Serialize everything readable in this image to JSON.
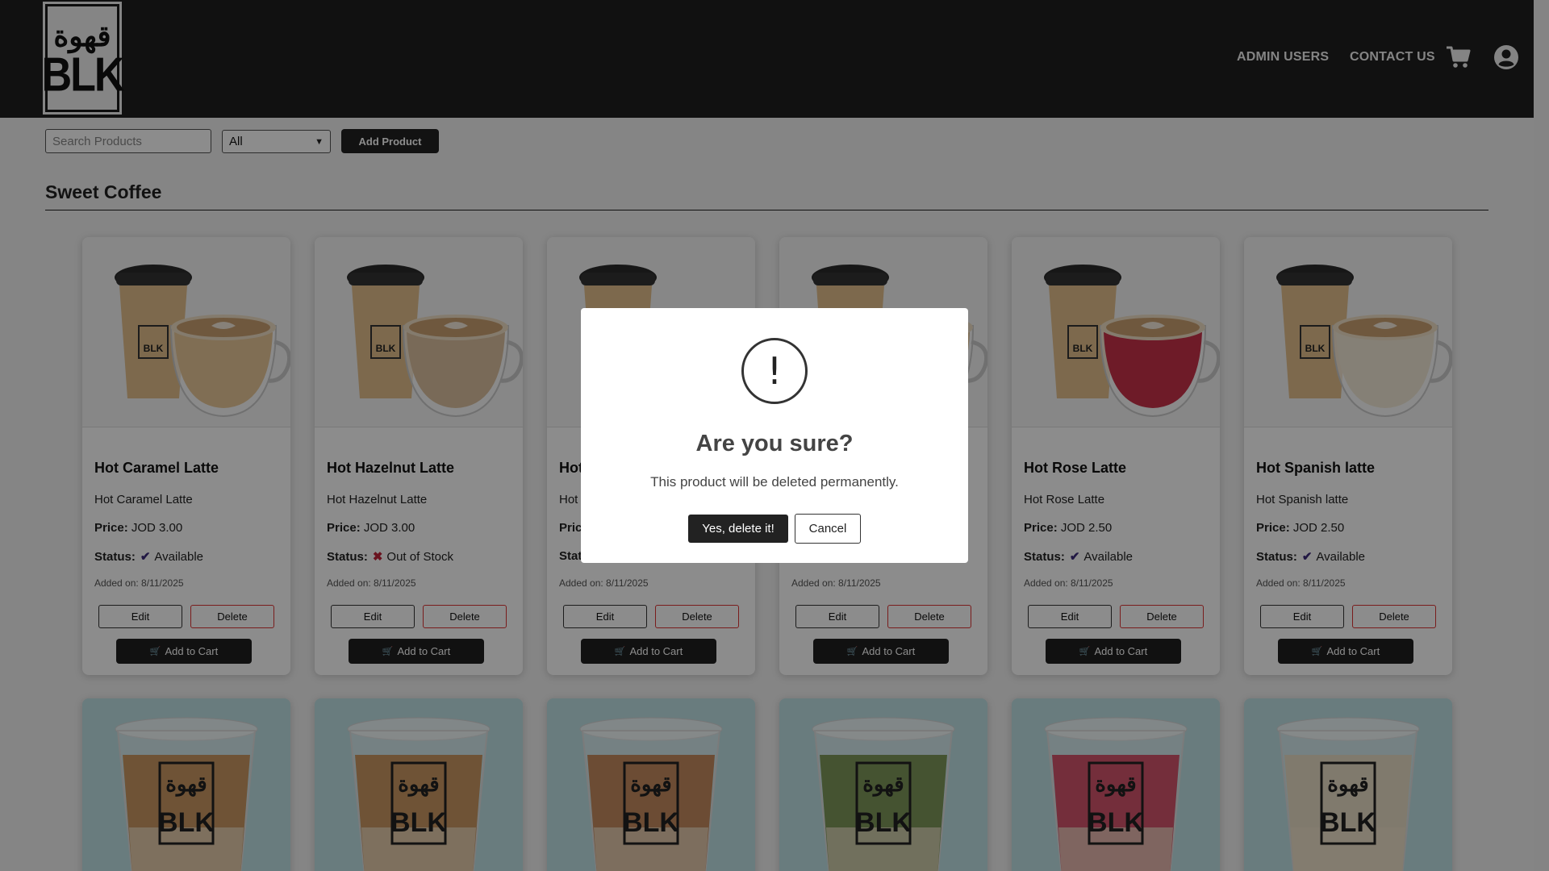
{
  "header": {
    "logo_arabic": "قهوة",
    "logo_text": "BLK",
    "nav": {
      "admin_users": "ADMIN USERS",
      "contact_us": "CONTACT US"
    },
    "icons": {
      "cart": "cart-icon",
      "account": "user-circle-icon"
    }
  },
  "toolbar": {
    "search_placeholder": "Search Products",
    "filter_value": "All",
    "add_product_label": "Add Product"
  },
  "section": {
    "title": "Sweet Coffee"
  },
  "labels": {
    "price": "Price:",
    "status": "Status:",
    "edit": "Edit",
    "delete": "Delete",
    "add_to_cart": "Add to Cart"
  },
  "products": [
    {
      "name": "Hot Caramel Latte",
      "description": "Hot Caramel Latte",
      "price": "JOD 3.00",
      "status": "Available",
      "available": true,
      "added": "Added on: 8/11/2025",
      "visible_name": "Hot Caramel Latte",
      "visible_desc": "Hot Caramel Latte",
      "visible_price_label": "Price:",
      "visible_status_label": "Status:"
    },
    {
      "name": "Hot Hazelnut Latte",
      "description": "Hot Hazelnut Latte",
      "price": "JOD 3.00",
      "status": "Out of Stock",
      "available": false,
      "added": "Added on: 8/11/2025",
      "visible_name": "Hot Hazelnut Latte",
      "visible_desc": "Hot Hazelnut Latte",
      "visible_price_label": "Price:",
      "visible_status_label": "Status:"
    },
    {
      "name": "Hot",
      "description": "Hot",
      "price": "",
      "status": "",
      "available": true,
      "added": "Added on: 8/11/2025",
      "visible_name": "Hot",
      "visible_desc": "Hot",
      "visible_price_label": "Pric",
      "visible_status_label": "Stat"
    },
    {
      "name": "",
      "description": "",
      "price": "",
      "status": "",
      "available": true,
      "added": "Added on: 8/11/2025",
      "visible_name": "",
      "visible_desc": "",
      "visible_price_label": "",
      "visible_status_label": ""
    },
    {
      "name": "Hot Rose Latte",
      "description": "Hot Rose Latte",
      "price": "JOD 2.50",
      "status": "Available",
      "available": true,
      "added": "Added on: 8/11/2025",
      "visible_name": "Hot Rose Latte",
      "visible_desc": "Hot Rose Latte",
      "visible_price_label": "Price:",
      "visible_status_label": "Status:"
    },
    {
      "name": "Hot Spanish latte",
      "description": "Hot Spanish latte",
      "price": "JOD 2.50",
      "status": "Available",
      "available": true,
      "added": "Added on: 8/11/2025",
      "visible_name": "Hot Spanish latte",
      "visible_desc": "Hot Spanish latte",
      "visible_price_label": "Price:",
      "visible_status_label": "Status:"
    }
  ],
  "product_image_accents": [
    "#e9c89a",
    "#dcc2a0",
    "#e6c79c",
    "#e6c79c",
    "#c8324a",
    "#f2ead8"
  ],
  "iced_image_accents": [
    "#c88a4a",
    "#c88a4a",
    "#c27a45",
    "#6f8a3e",
    "#d23a55",
    "#ecdcc0"
  ],
  "modal": {
    "icon": "exclamation-circle-icon",
    "symbol": "!",
    "title": "Are you sure?",
    "message": "This product will be deleted permanently.",
    "confirm_label": "Yes, delete it!",
    "cancel_label": "Cancel"
  },
  "colors": {
    "header_bg": "#1f1f1f",
    "button_dark": "#222222",
    "delete_border": "#dd3333",
    "overlay": "rgba(0,0,0,0.45)"
  }
}
